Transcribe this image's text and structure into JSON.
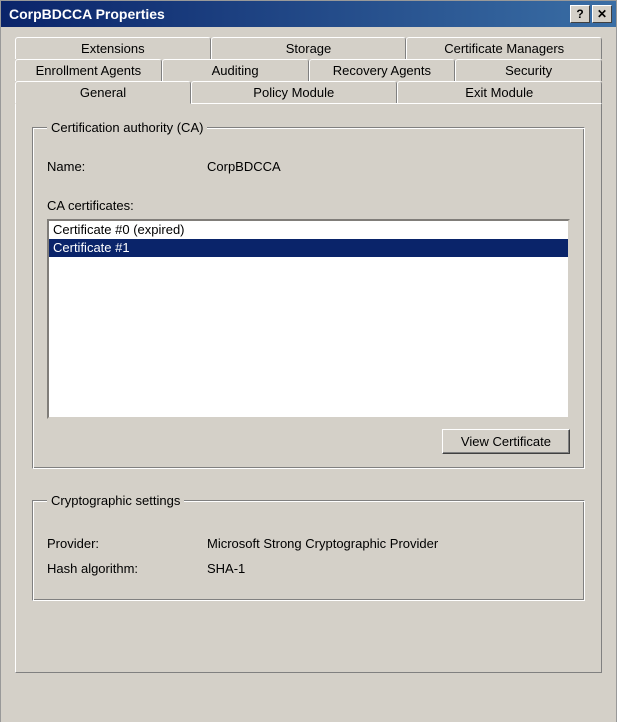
{
  "title": "CorpBDCCA Properties",
  "tabs": {
    "row1": [
      "Extensions",
      "Storage",
      "Certificate Managers"
    ],
    "row2": [
      "Enrollment Agents",
      "Auditing",
      "Recovery Agents",
      "Security"
    ],
    "row3": [
      "General",
      "Policy Module",
      "Exit Module"
    ],
    "active": "General"
  },
  "ca_group": {
    "legend": "Certification authority (CA)",
    "name_label": "Name:",
    "name_value": "CorpBDCCA",
    "certs_label": "CA certificates:",
    "certs": [
      {
        "label": "Certificate #0 (expired)",
        "selected": false
      },
      {
        "label": "Certificate #1",
        "selected": true
      }
    ],
    "view_btn": "View Certificate"
  },
  "crypto_group": {
    "legend": "Cryptographic settings",
    "provider_label": "Provider:",
    "provider_value": "Microsoft Strong Cryptographic Provider",
    "hash_label": "Hash algorithm:",
    "hash_value": "SHA-1"
  }
}
